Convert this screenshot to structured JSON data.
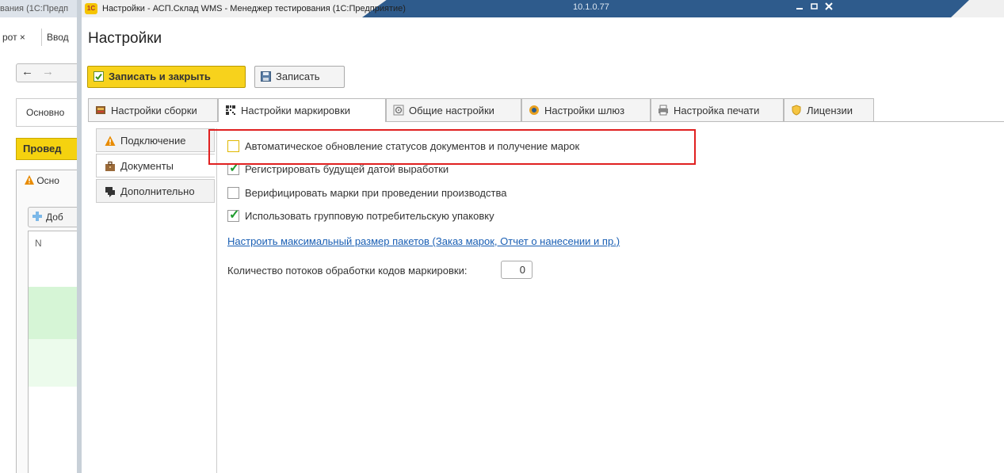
{
  "background_window": {
    "title": "вания (1С:Предп",
    "tab1": "рот ×",
    "tab2": "Ввод",
    "back_icon": "←",
    "fwd_icon": "→",
    "osn_label": "Основно",
    "post_button": "Провед",
    "section_label": "Осно",
    "add_button": "Доб",
    "col_n": "N"
  },
  "window": {
    "title": "Настройки - АСП.Склад WMS  - Менеджер тестирования (1С:Предприятие)",
    "ip": "10.1.0.77",
    "logo": "1С"
  },
  "page": {
    "title": "Настройки"
  },
  "toolbar": {
    "save_close_label": "Записать и закрыть",
    "save_label": "Записать"
  },
  "tabs": [
    {
      "label": "Настройки сборки",
      "icon": "assembly-icon"
    },
    {
      "label": "Настройки маркировки",
      "icon": "qr-code-icon",
      "active": true
    },
    {
      "label": "Общие настройки",
      "icon": "gear-icon"
    },
    {
      "label": "Настройки шлюз",
      "icon": "gateway-icon"
    },
    {
      "label": "Настройка печати",
      "icon": "printer-icon"
    },
    {
      "label": "Лицензии",
      "icon": "license-icon"
    }
  ],
  "sidebar": {
    "items": [
      {
        "label": "Подключение",
        "icon": "warning-icon"
      },
      {
        "label": "Документы",
        "icon": "briefcase-icon",
        "active": true
      },
      {
        "label": "Дополнительно",
        "icon": "chat-icon"
      }
    ]
  },
  "options": [
    {
      "label": "Автоматическое обновление статусов документов и получение марок",
      "checked": false
    },
    {
      "label": "Регистрировать будущей датой выработки",
      "checked": true
    },
    {
      "label": "Верифицировать марки при проведении производства",
      "checked": false
    },
    {
      "label": "Использовать групповую потребительскую упаковку",
      "checked": true
    }
  ],
  "link": {
    "label": "Настроить максимальный размер пакетов (Заказ марок, Отчет о нанесении и пр.)"
  },
  "threads": {
    "label": "Количество потоков обработки кодов маркировки:",
    "value": "0"
  },
  "colors": {
    "accent_yellow": "#f7d21c",
    "highlight_red": "#e02020",
    "link_blue": "#1a5fb4",
    "check_green": "#1f9c2e"
  }
}
